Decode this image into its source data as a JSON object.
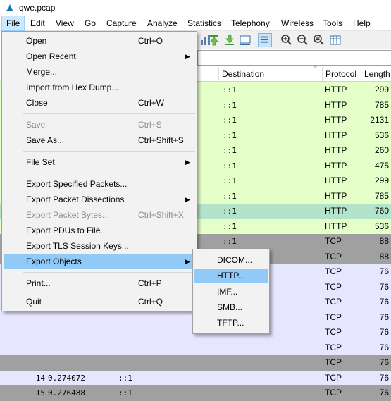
{
  "window": {
    "title": "qwe.pcap"
  },
  "menubar": {
    "items": [
      "File",
      "Edit",
      "View",
      "Go",
      "Capture",
      "Analyze",
      "Statistics",
      "Telephony",
      "Wireless",
      "Tools",
      "Help"
    ]
  },
  "packet_list": {
    "columns": {
      "destination": "Destination",
      "protocol": "Protocol",
      "length": "Length"
    },
    "rows": [
      {
        "no": "",
        "time": "",
        "src": "",
        "dst": "::1",
        "proto": "HTTP",
        "len": "299",
        "color": "#e4ffc7"
      },
      {
        "no": "",
        "time": "",
        "src": "",
        "dst": "::1",
        "proto": "HTTP",
        "len": "785",
        "color": "#e4ffc7"
      },
      {
        "no": "",
        "time": "",
        "src": "",
        "dst": "::1",
        "proto": "HTTP",
        "len": "2131",
        "color": "#e4ffc7"
      },
      {
        "no": "",
        "time": "",
        "src": "",
        "dst": "::1",
        "proto": "HTTP",
        "len": "536",
        "color": "#e4ffc7"
      },
      {
        "no": "",
        "time": "",
        "src": "",
        "dst": "::1",
        "proto": "HTTP",
        "len": "260",
        "color": "#e4ffc7"
      },
      {
        "no": "",
        "time": "",
        "src": "",
        "dst": "::1",
        "proto": "HTTP",
        "len": "475",
        "color": "#e4ffc7"
      },
      {
        "no": "",
        "time": "",
        "src": "",
        "dst": "::1",
        "proto": "HTTP",
        "len": "299",
        "color": "#e4ffc7"
      },
      {
        "no": "",
        "time": "",
        "src": "",
        "dst": "::1",
        "proto": "HTTP",
        "len": "785",
        "color": "#e4ffc7"
      },
      {
        "no": "",
        "time": "",
        "src": "",
        "dst": "::1",
        "proto": "HTTP",
        "len": "760",
        "color": "#b3e3c8"
      },
      {
        "no": "",
        "time": "",
        "src": "",
        "dst": "::1",
        "proto": "HTTP",
        "len": "536",
        "color": "#e4ffc7"
      },
      {
        "no": "",
        "time": "",
        "src": "",
        "dst": "::1",
        "proto": "TCP",
        "len": "88",
        "color": "#a0a0a0"
      },
      {
        "no": "",
        "time": "",
        "src": "",
        "dst": "::1",
        "proto": "TCP",
        "len": "88",
        "color": "#a0a0a0"
      },
      {
        "no": "",
        "time": "",
        "src": "",
        "dst": "::1",
        "proto": "TCP",
        "len": "76",
        "color": "#e7e6ff"
      },
      {
        "no": "",
        "time": "",
        "src": "",
        "dst": "::1",
        "proto": "TCP",
        "len": "76",
        "color": "#e7e6ff"
      },
      {
        "no": "",
        "time": "",
        "src": "",
        "dst": "",
        "proto": "TCP",
        "len": "76",
        "color": "#e7e6ff"
      },
      {
        "no": "",
        "time": "",
        "src": "",
        "dst": "",
        "proto": "TCP",
        "len": "76",
        "color": "#e7e6ff"
      },
      {
        "no": "",
        "time": "",
        "src": "",
        "dst": "",
        "proto": "TCP",
        "len": "76",
        "color": "#e7e6ff"
      },
      {
        "no": "",
        "time": "",
        "src": "",
        "dst": "",
        "proto": "TCP",
        "len": "76",
        "color": "#e7e6ff"
      },
      {
        "no": "",
        "time": "",
        "src": "",
        "dst": "",
        "proto": "TCP",
        "len": "76",
        "color": "#a0a0a0"
      },
      {
        "no": "14",
        "time": "0.274072",
        "src": "::1",
        "dst": "",
        "proto": "TCP",
        "len": "76",
        "color": "#e7e6ff"
      },
      {
        "no": "15",
        "time": "0.276488",
        "src": "::1",
        "dst": "",
        "proto": "TCP",
        "len": "76",
        "color": "#a0a0a0"
      }
    ]
  },
  "file_menu": {
    "items": [
      {
        "label": "Open",
        "shortcut": "Ctrl+O"
      },
      {
        "label": "Open Recent",
        "submenu": true
      },
      {
        "label": "Merge..."
      },
      {
        "label": "Import from Hex Dump..."
      },
      {
        "label": "Close",
        "shortcut": "Ctrl+W"
      },
      {
        "label": "Save",
        "shortcut": "Ctrl+S",
        "disabled": true
      },
      {
        "label": "Save As...",
        "shortcut": "Ctrl+Shift+S"
      },
      {
        "label": "File Set",
        "submenu": true
      },
      {
        "label": "Export Specified Packets..."
      },
      {
        "label": "Export Packet Dissections",
        "submenu": true
      },
      {
        "label": "Export Packet Bytes...",
        "shortcut": "Ctrl+Shift+X",
        "disabled": true
      },
      {
        "label": "Export PDUs to File..."
      },
      {
        "label": "Export TLS Session Keys..."
      },
      {
        "label": "Export Objects",
        "submenu": true,
        "highlighted": true
      },
      {
        "label": "Print...",
        "shortcut": "Ctrl+P"
      },
      {
        "label": "Quit",
        "shortcut": "Ctrl+Q"
      }
    ]
  },
  "export_objects_menu": {
    "items": [
      {
        "label": "DICOM..."
      },
      {
        "label": "HTTP...",
        "highlighted": true
      },
      {
        "label": "IMF..."
      },
      {
        "label": "SMB..."
      },
      {
        "label": "TFTP..."
      }
    ]
  },
  "icons": {
    "app": "wireshark-fin-icon",
    "submenu_arrow": "chevron-right-icon"
  },
  "colors": {
    "http_row": "#e4ffc7",
    "tcp_row": "#e7e6ff",
    "tcp_gray_row": "#a0a0a0",
    "menu_highlight": "#91c9f7"
  }
}
